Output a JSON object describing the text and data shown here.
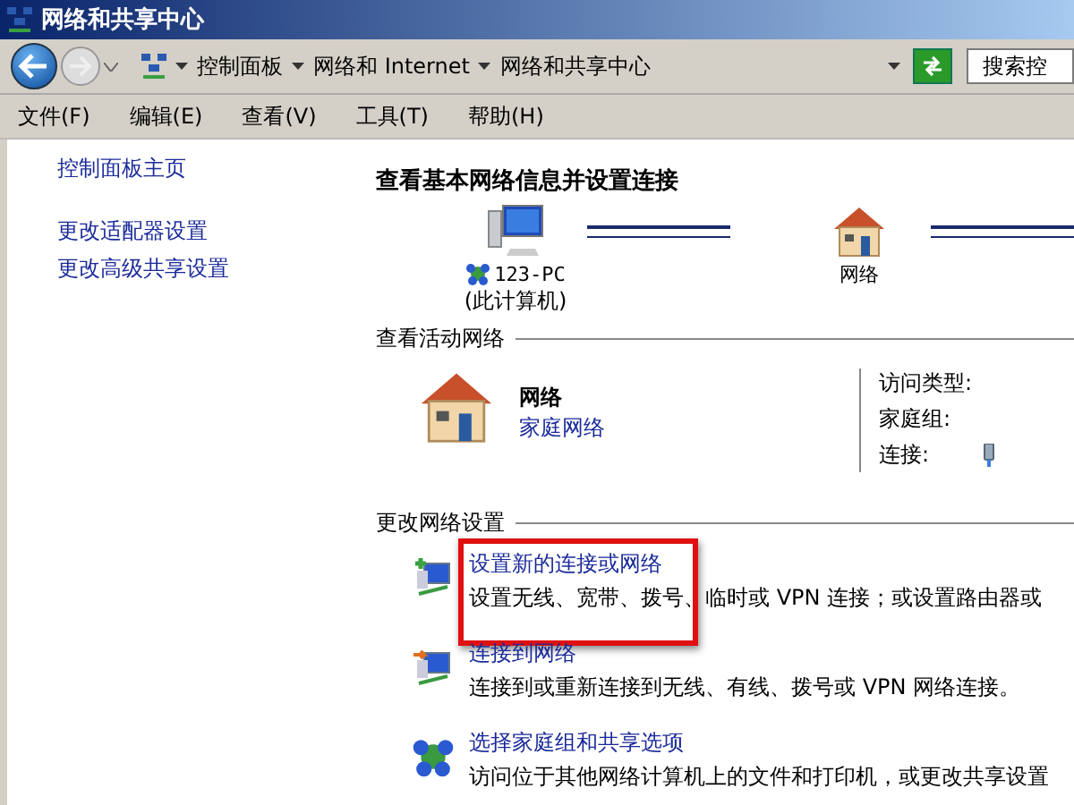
{
  "window": {
    "title": "网络和共享中心"
  },
  "address_bar": {
    "breadcrumbs": [
      "控制面板",
      "网络和 Internet",
      "网络和共享中心"
    ],
    "search_placeholder": "搜索控"
  },
  "menu": [
    "文件(F)",
    "编辑(E)",
    "查看(V)",
    "工具(T)",
    "帮助(H)"
  ],
  "sidebar": {
    "links": [
      "控制面板主页",
      "更改适配器设置",
      "更改高级共享设置"
    ]
  },
  "main": {
    "heading": "查看基本网络信息并设置连接",
    "map": [
      {
        "kind": "computer",
        "label": "123-PC",
        "sublabel": "(此计算机)"
      },
      {
        "kind": "network",
        "label": "网络"
      }
    ],
    "active_networks": {
      "title": "查看活动网络",
      "name": "网络",
      "type": "家庭网络",
      "properties": [
        "访问类型:",
        "家庭组:",
        "连接:"
      ]
    },
    "settings": {
      "title": "更改网络设置",
      "tasks": [
        {
          "kind": "new-connection",
          "title": "设置新的连接或网络",
          "description": "设置无线、宽带、拨号、临时或 VPN 连接；或设置路由器或",
          "highlighted": true
        },
        {
          "kind": "connect",
          "title": "连接到网络",
          "description": "连接到或重新连接到无线、有线、拨号或 VPN 网络连接。",
          "highlighted": false
        },
        {
          "kind": "homegroup",
          "title": "选择家庭组和共享选项",
          "description": "访问位于其他网络计算机上的文件和打印机，或更改共享设置",
          "highlighted": false
        }
      ]
    }
  }
}
